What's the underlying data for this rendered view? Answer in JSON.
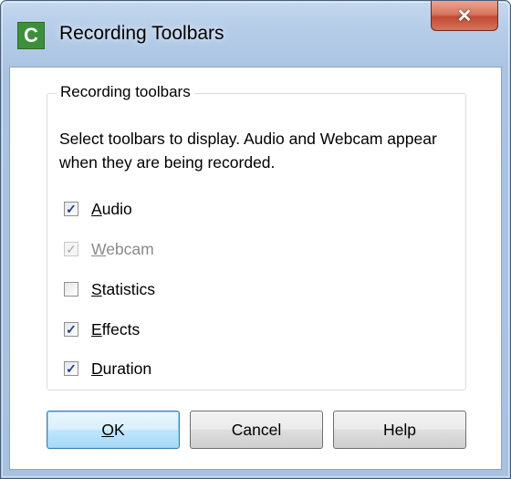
{
  "window": {
    "title": "Recording Toolbars",
    "icon_letter": "C",
    "close_glyph": "✕"
  },
  "group": {
    "label": "Recording toolbars",
    "description": "Select toolbars to display. Audio and Webcam appear when they are being recorded."
  },
  "checkboxes": [
    {
      "label": "Audio",
      "checked": true,
      "enabled": true
    },
    {
      "label": "Webcam",
      "checked": true,
      "enabled": false
    },
    {
      "label": "Statistics",
      "checked": false,
      "enabled": true
    },
    {
      "label": "Effects",
      "checked": true,
      "enabled": true
    },
    {
      "label": "Duration",
      "checked": true,
      "enabled": true
    }
  ],
  "buttons": {
    "ok": "OK",
    "cancel": "Cancel",
    "help": "Help"
  },
  "glyphs": {
    "check": "✓"
  },
  "colors": {
    "titlebar": "#b6cde8",
    "close_button": "#c14a33",
    "default_button_border": "#3c7fb1",
    "icon_green": "#3e8f3b"
  }
}
